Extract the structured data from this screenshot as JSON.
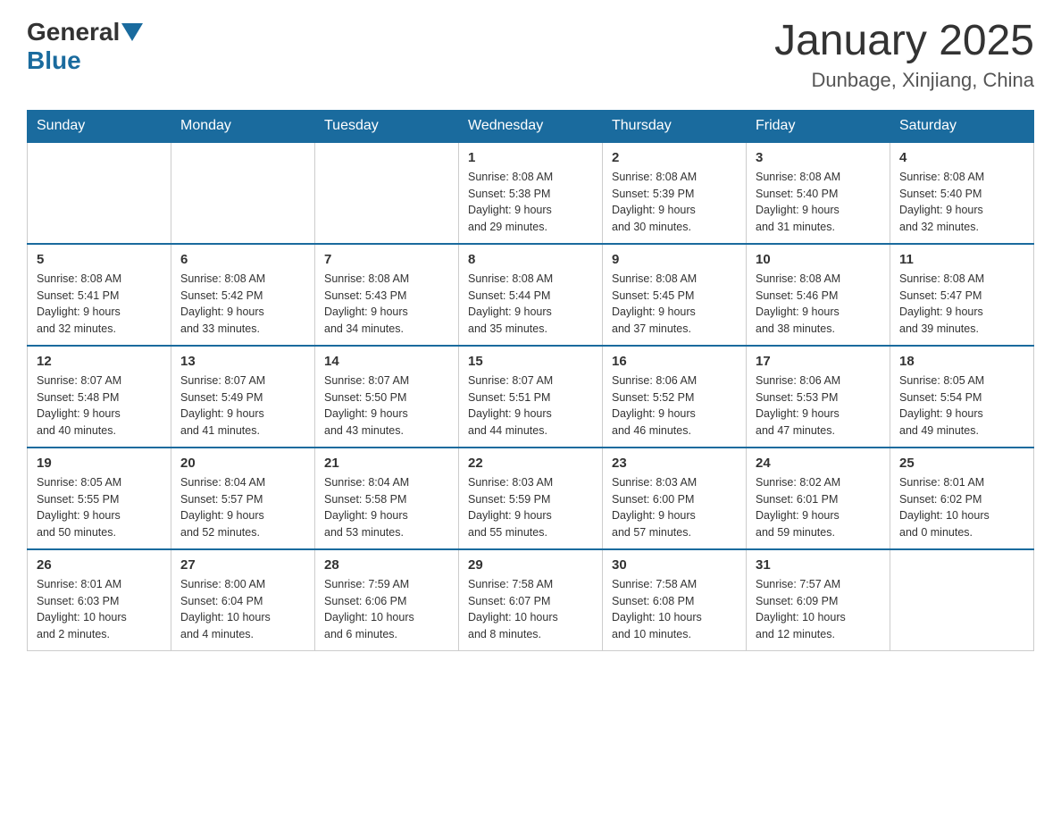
{
  "header": {
    "logo_general": "General",
    "logo_blue": "Blue",
    "month_title": "January 2025",
    "location": "Dunbage, Xinjiang, China"
  },
  "days_of_week": [
    "Sunday",
    "Monday",
    "Tuesday",
    "Wednesday",
    "Thursday",
    "Friday",
    "Saturday"
  ],
  "weeks": [
    [
      {
        "day": "",
        "info": ""
      },
      {
        "day": "",
        "info": ""
      },
      {
        "day": "",
        "info": ""
      },
      {
        "day": "1",
        "info": "Sunrise: 8:08 AM\nSunset: 5:38 PM\nDaylight: 9 hours\nand 29 minutes."
      },
      {
        "day": "2",
        "info": "Sunrise: 8:08 AM\nSunset: 5:39 PM\nDaylight: 9 hours\nand 30 minutes."
      },
      {
        "day": "3",
        "info": "Sunrise: 8:08 AM\nSunset: 5:40 PM\nDaylight: 9 hours\nand 31 minutes."
      },
      {
        "day": "4",
        "info": "Sunrise: 8:08 AM\nSunset: 5:40 PM\nDaylight: 9 hours\nand 32 minutes."
      }
    ],
    [
      {
        "day": "5",
        "info": "Sunrise: 8:08 AM\nSunset: 5:41 PM\nDaylight: 9 hours\nand 32 minutes."
      },
      {
        "day": "6",
        "info": "Sunrise: 8:08 AM\nSunset: 5:42 PM\nDaylight: 9 hours\nand 33 minutes."
      },
      {
        "day": "7",
        "info": "Sunrise: 8:08 AM\nSunset: 5:43 PM\nDaylight: 9 hours\nand 34 minutes."
      },
      {
        "day": "8",
        "info": "Sunrise: 8:08 AM\nSunset: 5:44 PM\nDaylight: 9 hours\nand 35 minutes."
      },
      {
        "day": "9",
        "info": "Sunrise: 8:08 AM\nSunset: 5:45 PM\nDaylight: 9 hours\nand 37 minutes."
      },
      {
        "day": "10",
        "info": "Sunrise: 8:08 AM\nSunset: 5:46 PM\nDaylight: 9 hours\nand 38 minutes."
      },
      {
        "day": "11",
        "info": "Sunrise: 8:08 AM\nSunset: 5:47 PM\nDaylight: 9 hours\nand 39 minutes."
      }
    ],
    [
      {
        "day": "12",
        "info": "Sunrise: 8:07 AM\nSunset: 5:48 PM\nDaylight: 9 hours\nand 40 minutes."
      },
      {
        "day": "13",
        "info": "Sunrise: 8:07 AM\nSunset: 5:49 PM\nDaylight: 9 hours\nand 41 minutes."
      },
      {
        "day": "14",
        "info": "Sunrise: 8:07 AM\nSunset: 5:50 PM\nDaylight: 9 hours\nand 43 minutes."
      },
      {
        "day": "15",
        "info": "Sunrise: 8:07 AM\nSunset: 5:51 PM\nDaylight: 9 hours\nand 44 minutes."
      },
      {
        "day": "16",
        "info": "Sunrise: 8:06 AM\nSunset: 5:52 PM\nDaylight: 9 hours\nand 46 minutes."
      },
      {
        "day": "17",
        "info": "Sunrise: 8:06 AM\nSunset: 5:53 PM\nDaylight: 9 hours\nand 47 minutes."
      },
      {
        "day": "18",
        "info": "Sunrise: 8:05 AM\nSunset: 5:54 PM\nDaylight: 9 hours\nand 49 minutes."
      }
    ],
    [
      {
        "day": "19",
        "info": "Sunrise: 8:05 AM\nSunset: 5:55 PM\nDaylight: 9 hours\nand 50 minutes."
      },
      {
        "day": "20",
        "info": "Sunrise: 8:04 AM\nSunset: 5:57 PM\nDaylight: 9 hours\nand 52 minutes."
      },
      {
        "day": "21",
        "info": "Sunrise: 8:04 AM\nSunset: 5:58 PM\nDaylight: 9 hours\nand 53 minutes."
      },
      {
        "day": "22",
        "info": "Sunrise: 8:03 AM\nSunset: 5:59 PM\nDaylight: 9 hours\nand 55 minutes."
      },
      {
        "day": "23",
        "info": "Sunrise: 8:03 AM\nSunset: 6:00 PM\nDaylight: 9 hours\nand 57 minutes."
      },
      {
        "day": "24",
        "info": "Sunrise: 8:02 AM\nSunset: 6:01 PM\nDaylight: 9 hours\nand 59 minutes."
      },
      {
        "day": "25",
        "info": "Sunrise: 8:01 AM\nSunset: 6:02 PM\nDaylight: 10 hours\nand 0 minutes."
      }
    ],
    [
      {
        "day": "26",
        "info": "Sunrise: 8:01 AM\nSunset: 6:03 PM\nDaylight: 10 hours\nand 2 minutes."
      },
      {
        "day": "27",
        "info": "Sunrise: 8:00 AM\nSunset: 6:04 PM\nDaylight: 10 hours\nand 4 minutes."
      },
      {
        "day": "28",
        "info": "Sunrise: 7:59 AM\nSunset: 6:06 PM\nDaylight: 10 hours\nand 6 minutes."
      },
      {
        "day": "29",
        "info": "Sunrise: 7:58 AM\nSunset: 6:07 PM\nDaylight: 10 hours\nand 8 minutes."
      },
      {
        "day": "30",
        "info": "Sunrise: 7:58 AM\nSunset: 6:08 PM\nDaylight: 10 hours\nand 10 minutes."
      },
      {
        "day": "31",
        "info": "Sunrise: 7:57 AM\nSunset: 6:09 PM\nDaylight: 10 hours\nand 12 minutes."
      },
      {
        "day": "",
        "info": ""
      }
    ]
  ]
}
